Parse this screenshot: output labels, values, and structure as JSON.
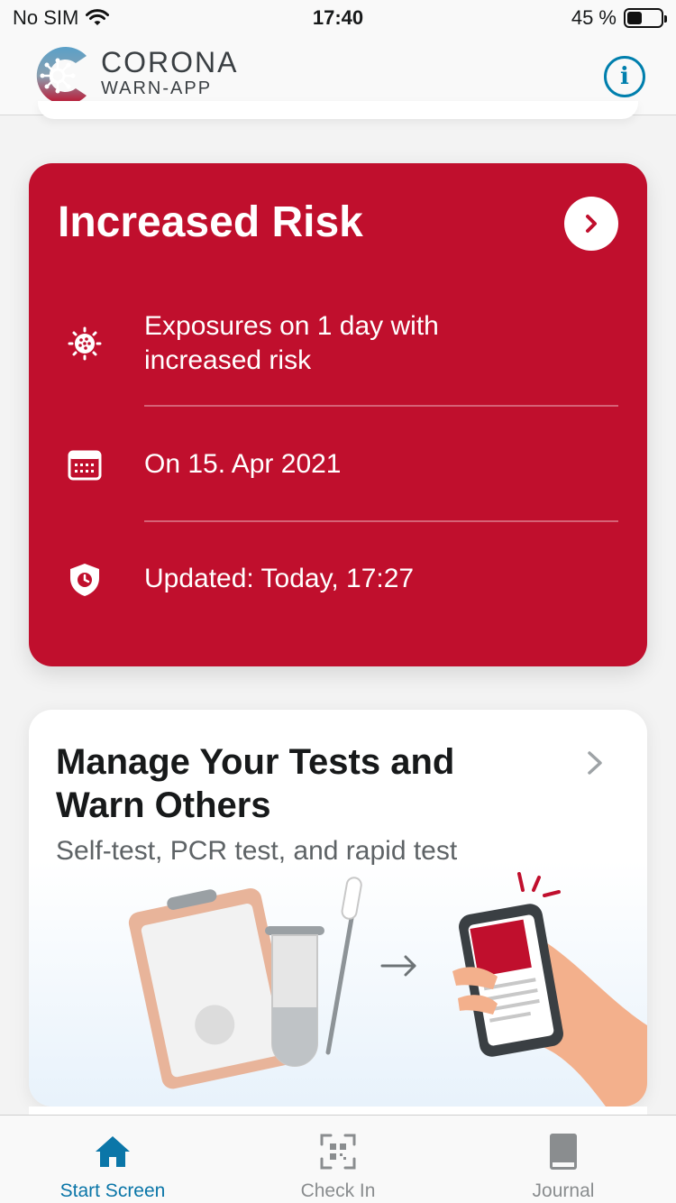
{
  "status_bar": {
    "carrier": "No SIM",
    "time": "17:40",
    "battery": "45 %",
    "battery_level": 0.45,
    "icons": [
      "wifi-icon",
      "battery-icon"
    ]
  },
  "header": {
    "logo_title": "CORONA",
    "logo_subtitle": "WARN-APP",
    "info_icon": "info-icon",
    "info_label": "i"
  },
  "risk_card": {
    "title": "Increased Risk",
    "color": "#c00f2d",
    "rows": [
      {
        "icon": "virus-icon",
        "text": "Exposures on 1 day with increased risk"
      },
      {
        "icon": "calendar-icon",
        "text": "On 15. Apr 2021"
      },
      {
        "icon": "shield-clock-icon",
        "text": "Updated: Today, 17:27"
      }
    ]
  },
  "tests_card": {
    "title": "Manage Your Tests and Warn Others",
    "subtitle": "Self-test, PCR test, and rapid test"
  },
  "tab_bar": {
    "active_color": "#0b76a8",
    "tabs": [
      {
        "label": "Start Screen",
        "icon": "home-icon",
        "active": true
      },
      {
        "label": "Check In",
        "icon": "qr-scan-icon",
        "active": false
      },
      {
        "label": "Journal",
        "icon": "book-icon",
        "active": false
      }
    ]
  }
}
